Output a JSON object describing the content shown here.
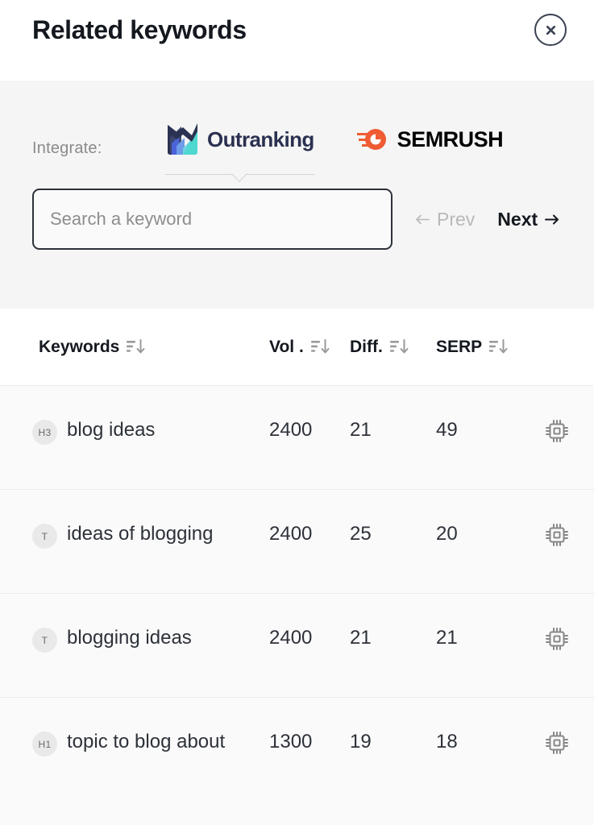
{
  "header": {
    "title": "Related keywords",
    "close_icon": "close-circle-icon"
  },
  "integrate": {
    "label": "Integrate:",
    "providers": [
      {
        "name": "Outranking",
        "icon": "outranking-logo-icon",
        "selected": true
      },
      {
        "name": "SEMRUSH",
        "icon": "semrush-comet-icon",
        "selected": false
      }
    ]
  },
  "search": {
    "placeholder": "Search a keyword",
    "value": ""
  },
  "pagination": {
    "prev_label": "Prev",
    "prev_icon": "arrow-left-icon",
    "prev_enabled": false,
    "next_label": "Next",
    "next_icon": "arrow-right-icon",
    "next_enabled": true
  },
  "table": {
    "columns": [
      {
        "label": "Keywords",
        "sort_icon": "sort-descending-icon"
      },
      {
        "label": "Vol .",
        "sort_icon": "sort-descending-icon"
      },
      {
        "label": "Diff.",
        "sort_icon": "sort-descending-icon"
      },
      {
        "label": "SERP",
        "sort_icon": "sort-descending-icon"
      }
    ],
    "rows": [
      {
        "tag": "H3",
        "keyword": "blog ideas",
        "vol": "2400",
        "diff": "21",
        "serp": "49",
        "action_icon": "cpu-chip-icon"
      },
      {
        "tag": "T",
        "keyword": "ideas of blogging",
        "vol": "2400",
        "diff": "25",
        "serp": "20",
        "action_icon": "cpu-chip-icon"
      },
      {
        "tag": "T",
        "keyword": "blogging ideas",
        "vol": "2400",
        "diff": "21",
        "serp": "21",
        "action_icon": "cpu-chip-icon"
      },
      {
        "tag": "H1",
        "keyword": "topic to blog about",
        "vol": "1300",
        "diff": "19",
        "serp": "18",
        "action_icon": "cpu-chip-icon"
      }
    ]
  },
  "colors": {
    "band_bg": "#f5f5f5",
    "body_bg": "#fafafa",
    "text_primary": "#2d3139",
    "text_muted": "#8a8a8a",
    "semrush_orange": "#ef5c33",
    "outranking_navy": "#2b3150",
    "outranking_teal": "#4fd8d0",
    "outranking_blue": "#4a63d8"
  }
}
